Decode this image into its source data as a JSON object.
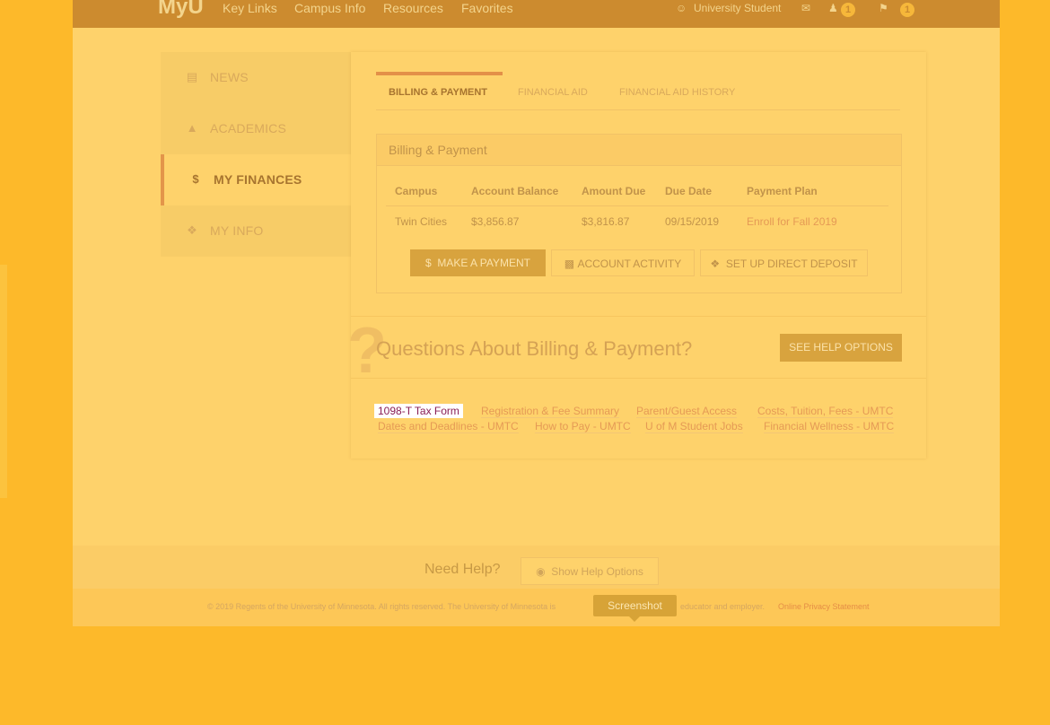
{
  "topbar": {
    "brand": "MyU",
    "nav": [
      "Key Links",
      "Campus Info",
      "Resources",
      "Favorites"
    ],
    "user": "University Student",
    "badge1": "1",
    "badge2": "1"
  },
  "sidebar": {
    "items": [
      {
        "icon": "newspaper-icon",
        "label": "NEWS"
      },
      {
        "icon": "graduation-cap-icon",
        "label": "ACADEMICS"
      },
      {
        "icon": "dollar-icon",
        "label": "MY FINANCES"
      },
      {
        "icon": "info-icon",
        "label": "MY INFO"
      }
    ]
  },
  "tabs": [
    "BILLING & PAYMENT",
    "FINANCIAL AID",
    "FINANCIAL AID HISTORY"
  ],
  "billing": {
    "title": "Billing & Payment",
    "columns": [
      "Campus",
      "Account Balance",
      "Amount Due",
      "Due Date",
      "Payment Plan"
    ],
    "row": {
      "campus": "Twin Cities",
      "balance": "$3,856.87",
      "due": "$3,816.87",
      "date": "09/15/2019",
      "plan": "Enroll for Fall 2019"
    },
    "buttons": {
      "pay": "MAKE A PAYMENT",
      "activity": "ACCOUNT ACTIVITY",
      "deposit": "SET UP DIRECT DEPOSIT"
    }
  },
  "questions": {
    "title": "Questions About Billing & Payment?",
    "help_button": "SEE HELP OPTIONS",
    "links": [
      "1098-T Tax Form",
      "Registration & Fee Summary",
      "Parent/Guest Access",
      "Costs, Tuition, Fees - UMTC",
      "Dates and Deadlines - UMTC",
      "How to Pay - UMTC",
      "U of M Student Jobs",
      "Financial Wellness - UMTC"
    ]
  },
  "help": {
    "text": "Need Help?",
    "button": "Show Help Options"
  },
  "footer": {
    "text": "© 2019 Regents of the University of Minnesota. All rights reserved. The University of Minnesota is",
    "text2": "educator and employer.",
    "link": "Online Privacy Statement"
  },
  "tooltip": "Screenshot",
  "colors": {
    "accent": "#E39048",
    "background": "#FDB92A",
    "topbar": "#CC8B2F"
  }
}
